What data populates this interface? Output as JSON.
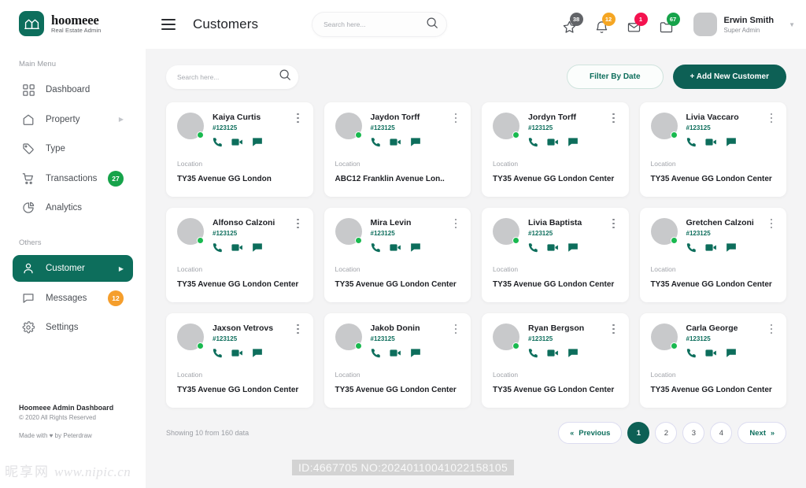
{
  "brand": {
    "name": "hoomeee",
    "subtitle": "Real Estate Admin",
    "logo_icon": "home-logo-icon"
  },
  "sidebar": {
    "main_label": "Main Menu",
    "others_label": "Others",
    "items": [
      {
        "label": "Dashboard",
        "icon": "grid-icon",
        "badge": null,
        "caret": false,
        "active": false
      },
      {
        "label": "Property",
        "icon": "home-icon",
        "badge": null,
        "caret": true,
        "active": false
      },
      {
        "label": "Type",
        "icon": "tag-icon",
        "badge": null,
        "caret": false,
        "active": false
      },
      {
        "label": "Transactions",
        "icon": "cart-icon",
        "badge": "27",
        "badge_color": "green",
        "caret": false,
        "active": false
      },
      {
        "label": "Analytics",
        "icon": "pie-chart-icon",
        "badge": null,
        "caret": false,
        "active": false
      }
    ],
    "others": [
      {
        "label": "Customer",
        "icon": "user-icon",
        "badge": null,
        "caret": true,
        "active": true
      },
      {
        "label": "Messages",
        "icon": "message-icon",
        "badge": "12",
        "badge_color": "orange",
        "caret": false,
        "active": false
      },
      {
        "label": "Settings",
        "icon": "gear-icon",
        "badge": null,
        "caret": false,
        "active": false
      }
    ],
    "footer": {
      "title": "Hoomeee Admin Dashboard",
      "copyright": "© 2020 All Rights Reserved",
      "made_by": "Made with ♥ by Peterdraw"
    }
  },
  "header": {
    "menu_icon": "hamburger-icon",
    "title": "Customers",
    "search": {
      "placeholder": "Search here...",
      "value": "",
      "icon": "search-icon"
    },
    "icons": [
      {
        "name": "star-icon",
        "count": "38",
        "color": "#626468"
      },
      {
        "name": "bell-icon",
        "count": "12",
        "color": "#f5a623"
      },
      {
        "name": "envelope-icon",
        "count": "1",
        "color": "#f4124f"
      },
      {
        "name": "folder-icon",
        "count": "67",
        "color": "#16a34a"
      }
    ],
    "profile": {
      "name": "Erwin Smith",
      "role": "Super Admin",
      "caret_icon": "chevron-down-icon"
    }
  },
  "toolbar": {
    "search": {
      "placeholder": "Search here...",
      "value": "",
      "icon": "search-icon"
    },
    "filter_label": "Filter By Date",
    "add_label": "+ Add New Customer"
  },
  "cards": {
    "location_label": "Location",
    "action_icons": [
      "phone-icon",
      "video-icon",
      "chat-icon"
    ],
    "kebab_icon": "more-vertical-icon",
    "status": "online",
    "items": [
      {
        "name": "Kaiya Curtis",
        "id": "#123125",
        "location": "TY35 Avenue GG London"
      },
      {
        "name": "Jaydon Torff",
        "id": "#123125",
        "location": "ABC12 Franklin Avenue Lon.."
      },
      {
        "name": "Jordyn Torff",
        "id": "#123125",
        "location": "TY35 Avenue GG London Center"
      },
      {
        "name": "Livia Vaccaro",
        "id": "#123125",
        "location": "TY35 Avenue GG London Center"
      },
      {
        "name": "Alfonso Calzoni",
        "id": "#123125",
        "location": "TY35 Avenue GG London Center"
      },
      {
        "name": "Mira Levin",
        "id": "#123125",
        "location": "TY35 Avenue GG London Center"
      },
      {
        "name": "Livia Baptista",
        "id": "#123125",
        "location": "TY35 Avenue GG London Center"
      },
      {
        "name": "Gretchen Calzoni",
        "id": "#123125",
        "location": "TY35 Avenue GG London Center"
      },
      {
        "name": "Jaxson Vetrovs",
        "id": "#123125",
        "location": "TY35 Avenue GG London Center"
      },
      {
        "name": "Jakob Donin",
        "id": "#123125",
        "location": "TY35 Avenue GG London Center"
      },
      {
        "name": "Ryan Bergson",
        "id": "#123125",
        "location": "TY35 Avenue GG London Center"
      },
      {
        "name": "Carla George",
        "id": "#123125",
        "location": "TY35 Avenue GG London Center"
      }
    ]
  },
  "footer": {
    "showing": "Showing 10 from 160 data",
    "pagination": {
      "previous_label": "Previous",
      "next_label": "Next",
      "pages": [
        "1",
        "2",
        "3",
        "4"
      ],
      "active_page": "1"
    }
  },
  "watermarks": {
    "left_cjk": "昵享网",
    "left_url": "www.nipic.cn",
    "center": "ID:4667705 NO:20240110041022158105"
  },
  "colors": {
    "brand_green": "#0d6e5c",
    "button_green": "#0d6055",
    "online_green": "#19b94f",
    "badge_green": "#16a34a",
    "badge_orange": "#f5a623",
    "badge_red": "#f4124f",
    "badge_gray": "#626468"
  }
}
